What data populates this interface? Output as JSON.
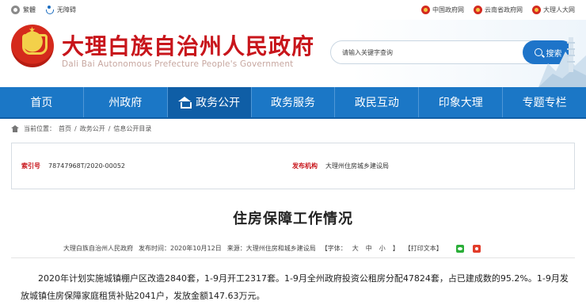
{
  "topbar": {
    "simplified": "繁體",
    "accessibility": "无障碍",
    "links": [
      "中国政府网",
      "云南省政府网",
      "大理人大网"
    ]
  },
  "header": {
    "title": "大理白族自治州人民政府",
    "subtitle": "Dali Bai Autonomous Prefecture People's Government",
    "search_placeholder": "请输入关键字查询",
    "search_button": "搜索"
  },
  "nav": {
    "items": [
      "首页",
      "州政府",
      "政务公开",
      "政务服务",
      "政民互动",
      "印象大理",
      "专题专栏"
    ],
    "active_index": 2
  },
  "breadcrumb": {
    "prefix": "当前位置：",
    "items": [
      "首页",
      "政务公开",
      "信息公开目录"
    ],
    "separator": "/"
  },
  "info": {
    "index_label": "索引号",
    "index_value": "78747968T/2020-00052",
    "publisher_label": "发布机构",
    "publisher_value": "大理州住房城乡建设局"
  },
  "article": {
    "title": "住房保障工作情况",
    "source": "大理白族自治州人民政府",
    "date": "发布时间：2020年10月12日",
    "origin": "来源：大理州住房和城乡建设局",
    "font_label": "【字体：",
    "font_sizes": [
      "大",
      "中",
      "小"
    ],
    "font_close": "】",
    "print": "【打印文本】",
    "body": "2020年计划实施城镇棚户区改造2840套，1-9月开工2317套。1-9月全州政府投资公租房分配47824套，占已建成数的95.2%。1-9月发放城镇住房保障家庭租赁补贴2041户，发放金额147.63万元。"
  },
  "colors": {
    "brand_red": "#c8151b",
    "nav_blue": "#1b77c6",
    "nav_active": "#0f5ea6",
    "search_blue": "#1e74c9"
  }
}
